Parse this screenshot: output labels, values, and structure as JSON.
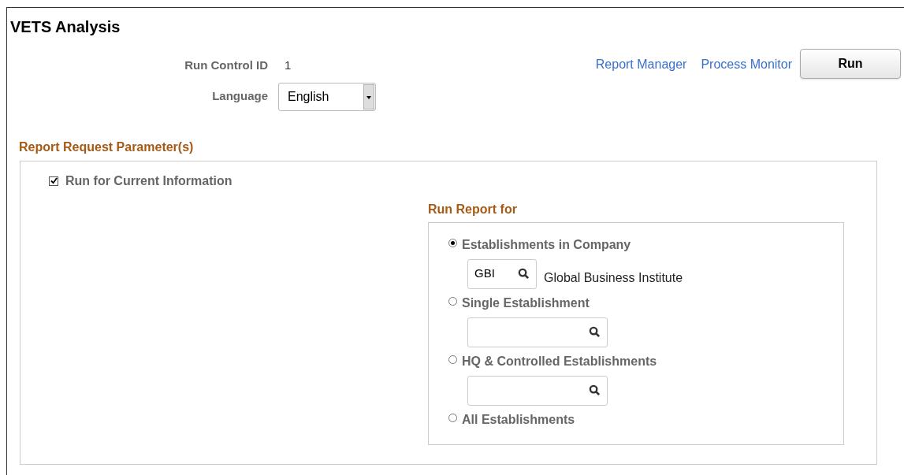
{
  "page_title": "VETS Analysis",
  "run_control": {
    "label": "Run Control ID",
    "value": "1"
  },
  "language": {
    "label": "Language",
    "value": "English"
  },
  "links": [
    "Report Manager",
    "Process Monitor"
  ],
  "run_button": "Run",
  "section": {
    "title": "Report Request Parameter(s)",
    "current_info": {
      "label": "Run for Current Information",
      "checked": true
    },
    "run_report_for": {
      "title": "Run Report for",
      "options": [
        {
          "kind": "lookup",
          "label": "Establishments in Company",
          "selected": true,
          "field": {
            "value": "GBI",
            "description": "Global Business Institute"
          }
        },
        {
          "kind": "lookup",
          "label": "Single Establishment",
          "selected": false
        },
        {
          "kind": "lookup",
          "label": "HQ & Controlled Establishments",
          "selected": false
        },
        {
          "kind": "plain",
          "label": "All Establishments",
          "selected": false
        }
      ]
    }
  }
}
